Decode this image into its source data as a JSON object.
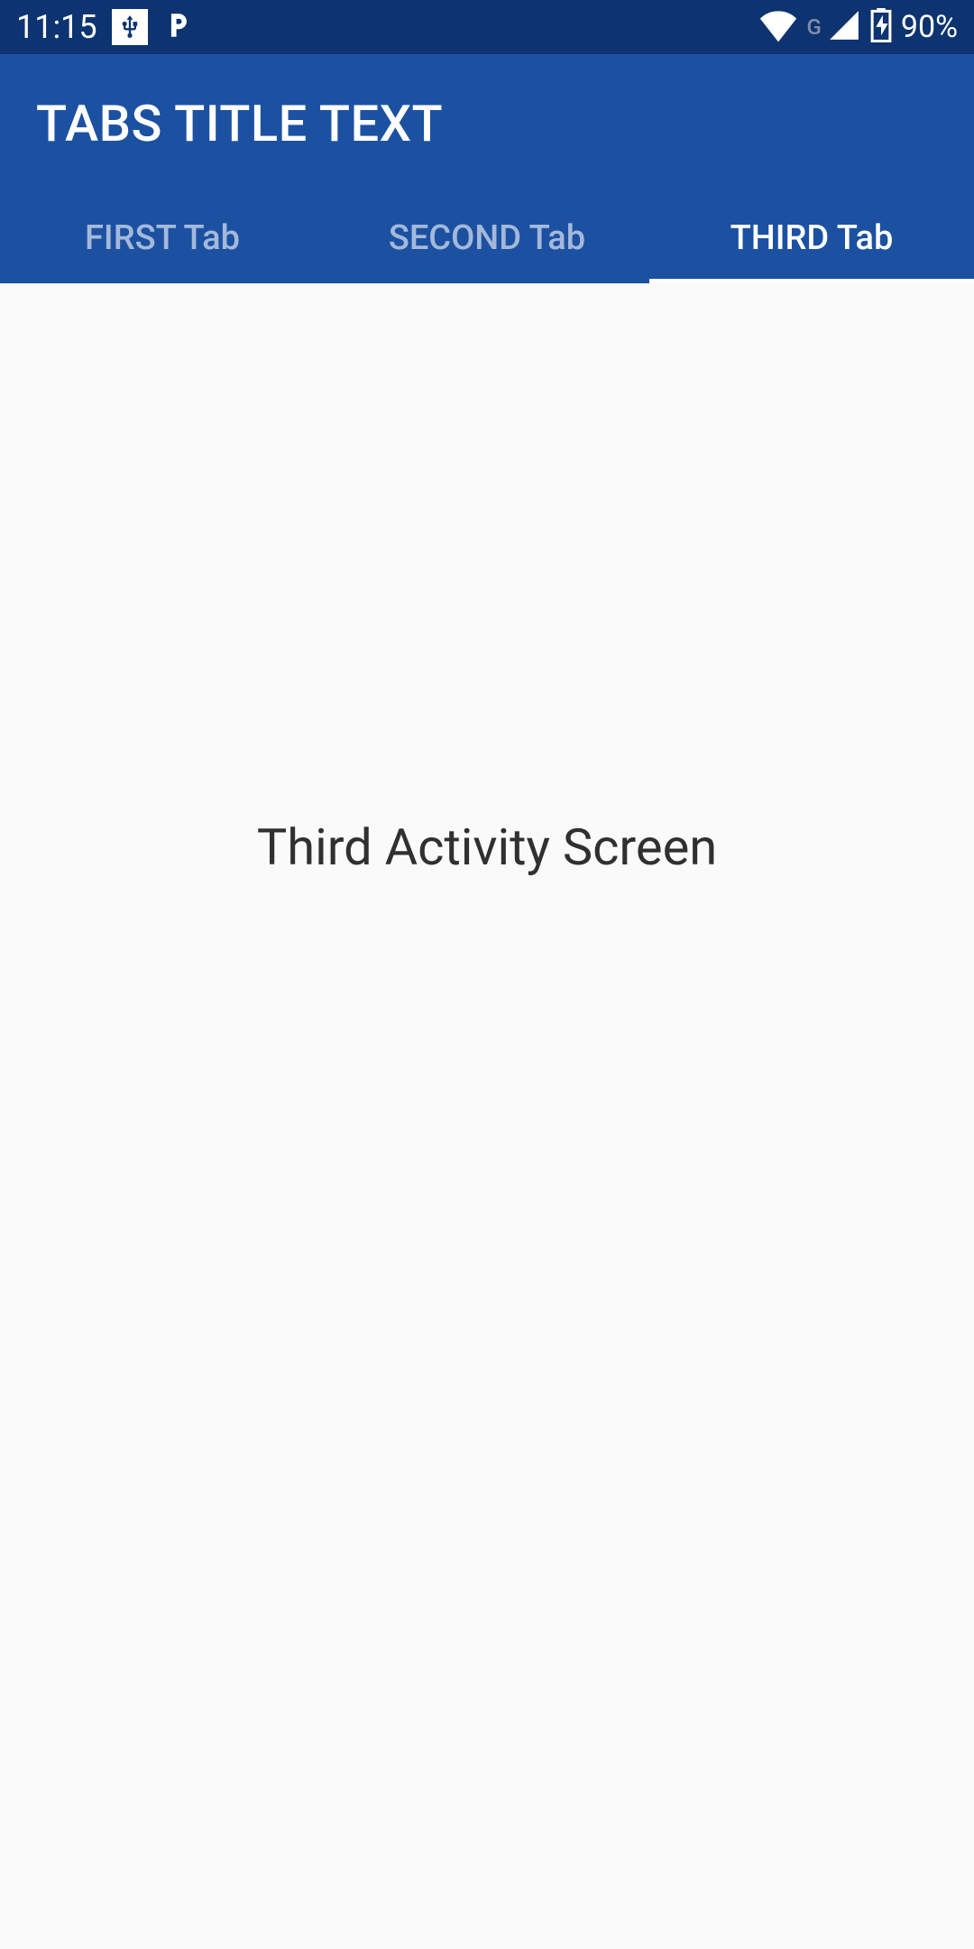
{
  "statusbar": {
    "time": "11:15",
    "battery_percent": "90%",
    "network_letter": "G"
  },
  "header": {
    "title": "TABS TITLE TEXT"
  },
  "tabs": [
    {
      "label": "FIRST Tab",
      "active": false
    },
    {
      "label": "SECOND Tab",
      "active": false
    },
    {
      "label": "THIRD Tab",
      "active": true
    }
  ],
  "main": {
    "content_text": "Third Activity Screen"
  },
  "colors": {
    "status_bar_bg": "#0d3370",
    "app_bar_bg": "#1c51a2",
    "content_bg": "#fafafa"
  }
}
